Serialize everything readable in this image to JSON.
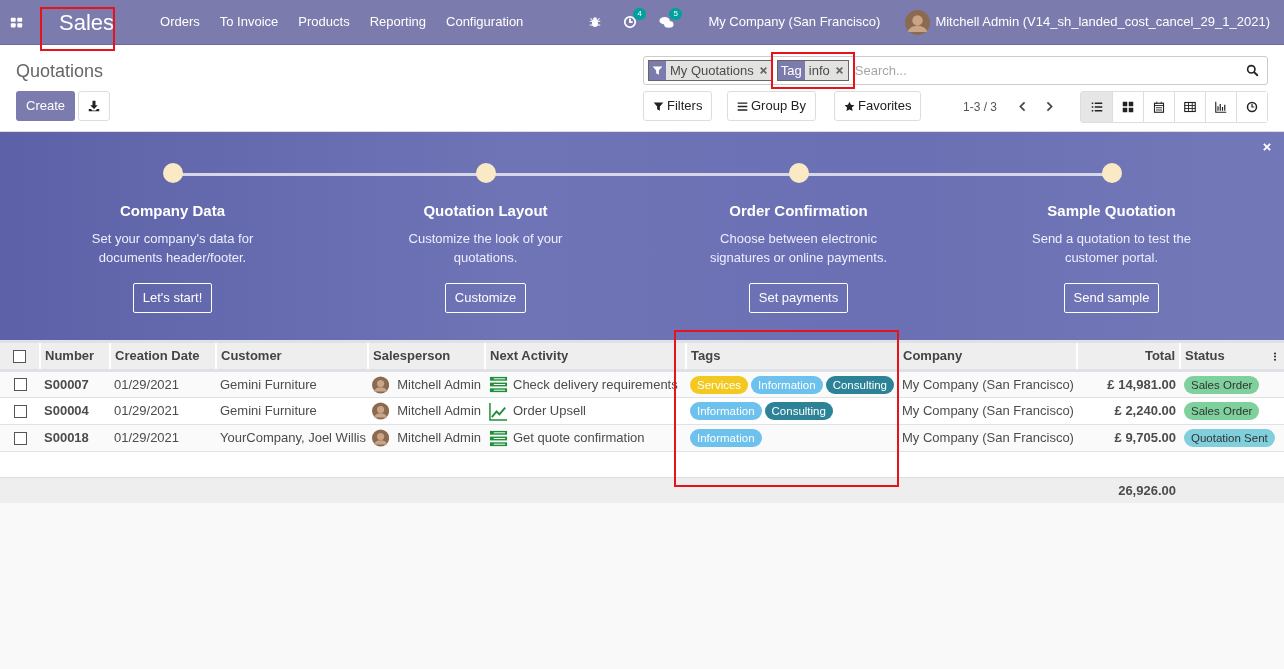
{
  "navbar": {
    "app": "Sales",
    "menu": [
      "Orders",
      "To Invoice",
      "Products",
      "Reporting",
      "Configuration"
    ],
    "activity_count": "4",
    "message_count": "5",
    "company": "My Company (San Francisco)",
    "user": "Mitchell Admin (V14_sh_landed_cost_cancel_29_1_2021)"
  },
  "control_panel": {
    "title": "Quotations",
    "create": "Create",
    "facets": [
      {
        "label": "My Quotations",
        "kind": "filter"
      },
      {
        "label": "info",
        "kind": "field",
        "field": "Tag"
      }
    ],
    "search": {
      "placeholder": "Search..."
    },
    "buttons": [
      "Filters",
      "Group By",
      "Favorites"
    ],
    "pager": "1-3 / 3",
    "views": [
      {
        "kind": "list",
        "selected": true
      },
      {
        "kind": "kanban",
        "selected": false
      },
      {
        "kind": "calendar",
        "selected": false
      },
      {
        "kind": "pivot",
        "selected": false
      },
      {
        "kind": "graph",
        "selected": false
      },
      {
        "kind": "activity",
        "selected": false
      }
    ]
  },
  "banner": {
    "steps": [
      {
        "title": "Company Data",
        "text": "Set your company's data for documents header/footer.",
        "button": "Let's start!"
      },
      {
        "title": "Quotation Layout",
        "text": "Customize the look of your quotations.",
        "button": "Customize"
      },
      {
        "title": "Order Confirmation",
        "text": "Choose between electronic signatures or online payments.",
        "button": "Set payments"
      },
      {
        "title": "Sample Quotation",
        "text": "Send a quotation to test the customer portal.",
        "button": "Send sample"
      }
    ]
  },
  "table": {
    "select_all_checked": false,
    "columns": [
      "Number",
      "Creation Date",
      "Customer",
      "Salesperson",
      "Next Activity",
      "Tags",
      "Company",
      "Total",
      "Status"
    ],
    "rows": [
      {
        "checked": false,
        "number": "S00007",
        "date": "01/29/2021",
        "customer": "Gemini Furniture",
        "salesperson": "Mitchell Admin",
        "activity": {
          "kind": "list",
          "text": "Check delivery requirements"
        },
        "tags": [
          {
            "label": "Services",
            "color": "#f4c91f"
          },
          {
            "label": "Information",
            "color": "#6cc1ed"
          },
          {
            "label": "Consulting",
            "color": "#2c8397"
          }
        ],
        "company": "My Company (San Francisco)",
        "total": "£ 14,981.00",
        "status": {
          "label": "Sales Order",
          "color": "#7ed09c"
        }
      },
      {
        "checked": false,
        "number": "S00004",
        "date": "01/29/2021",
        "customer": "Gemini Furniture",
        "salesperson": "Mitchell Admin",
        "activity": {
          "kind": "chart",
          "text": "Order Upsell"
        },
        "tags": [
          {
            "label": "Information",
            "color": "#6cc1ed"
          },
          {
            "label": "Consulting",
            "color": "#2c8397"
          }
        ],
        "company": "My Company (San Francisco)",
        "total": "£ 2,240.00",
        "status": {
          "label": "Sales Order",
          "color": "#7ed09c"
        }
      },
      {
        "checked": false,
        "number": "S00018",
        "date": "01/29/2021",
        "customer": "YourCompany, Joel Willis",
        "salesperson": "Mitchell Admin",
        "activity": {
          "kind": "list",
          "text": "Get quote confirmation"
        },
        "tags": [
          {
            "label": "Information",
            "color": "#6cc1ed"
          }
        ],
        "company": "My Company (San Francisco)",
        "total": "£ 9,705.00",
        "status": {
          "label": "Quotation Sent",
          "color": "#80cfdc"
        }
      }
    ],
    "sum_total": "26,926.00"
  }
}
